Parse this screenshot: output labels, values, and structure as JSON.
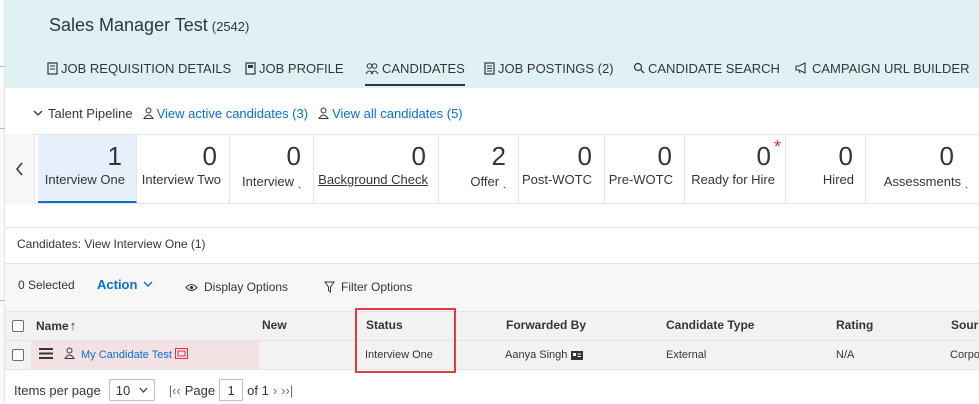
{
  "header": {
    "title": "Sales Manager Test",
    "requisition_id": "(2542)",
    "tabs": [
      {
        "label": "JOB REQUISITION DETAILS",
        "icon": "document-icon"
      },
      {
        "label": "JOB PROFILE",
        "icon": "profile-doc-icon"
      },
      {
        "label": "CANDIDATES",
        "icon": "people-icon",
        "active": true
      },
      {
        "label": "JOB POSTINGS (2)",
        "icon": "list-doc-icon"
      },
      {
        "label": "CANDIDATE SEARCH",
        "icon": "search-icon"
      },
      {
        "label": "CAMPAIGN URL BUILDER",
        "icon": "megaphone-icon"
      }
    ]
  },
  "pipeline": {
    "toggle_label": "Talent Pipeline",
    "active_link": "View active candidates (3)",
    "all_link": "View all candidates (5)",
    "stages": [
      {
        "count": "1",
        "name": "Interview One",
        "active": true
      },
      {
        "count": "0",
        "name": "Interview Two"
      },
      {
        "count": "0",
        "name": "Interview ˎ"
      },
      {
        "count": "0",
        "name": "Background Check",
        "underline": true
      },
      {
        "count": "2",
        "name": "Offer ˎ"
      },
      {
        "count": "0",
        "name": "Post-WOTC"
      },
      {
        "count": "0",
        "name": "Pre-WOTC"
      },
      {
        "count": "0",
        "name": "Ready for Hire",
        "flag": "*"
      },
      {
        "count": "0",
        "name": "Hired"
      },
      {
        "count": "0",
        "name": "Assessments ˎ"
      }
    ]
  },
  "candidates": {
    "panel_title": "Candidates: View Interview One (1)",
    "selected_label": "0 Selected",
    "action_label": "Action",
    "display_options_label": "Display Options",
    "filter_options_label": "Filter Options",
    "columns": [
      "Name",
      "New",
      "Status",
      "Forwarded By",
      "Candidate Type",
      "Rating",
      "Sour"
    ],
    "sort_indicator": "↑",
    "rows": [
      {
        "name": "My Candidate Test",
        "new": "",
        "status": "Interview One",
        "forwarded_by": "Aanya Singh",
        "candidate_type": "External",
        "rating": "N/A",
        "source": "Corpo"
      }
    ]
  },
  "pager": {
    "items_label": "Items per page",
    "items_value": "10",
    "page_label": "Page",
    "page_value": "1",
    "of_label": "of 1"
  },
  "colors": {
    "header_bg": "#dff1f2",
    "link": "#0a6ed1",
    "highlight": "#e03e3e",
    "active_stage_bg": "#e5f0fa"
  }
}
